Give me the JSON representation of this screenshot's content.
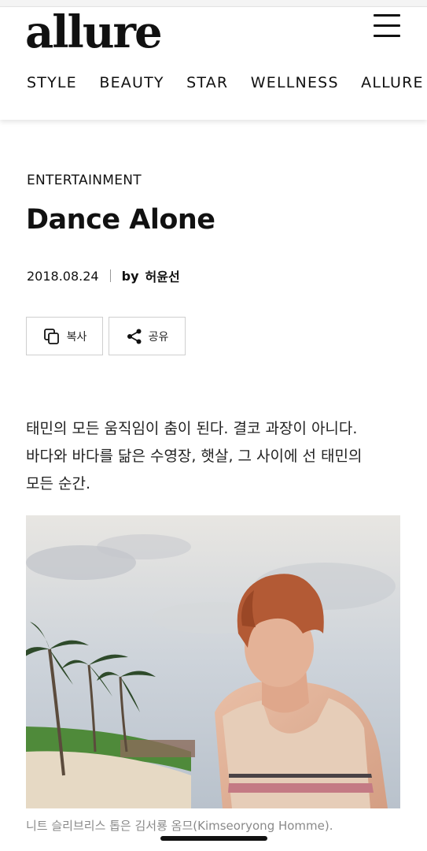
{
  "header": {
    "logo": "allure",
    "menu_icon": "hamburger-menu-icon",
    "nav": [
      "STYLE",
      "BEAUTY",
      "STAR",
      "WELLNESS",
      "ALLURE CLUB"
    ]
  },
  "article": {
    "category": "ENTERTAINMENT",
    "title": "Dance Alone",
    "date": "2018.08.24",
    "by": "by",
    "author": "허윤선",
    "lede_lines": [
      "태민의 모든 움직임이 춤이 된다. 결코 과장이 아니다.",
      "바다와 바다를 닮은 수영장, 햇살, 그 사이에 선 태민의",
      "모든 순간."
    ],
    "caption": "니트 슬리브리스 톱은 김서룡 옴므(Kimseoryong Homme)."
  },
  "actions": {
    "copy_label": "복사",
    "copy_icon": "copy-icon",
    "share_label": "공유",
    "share_icon": "share-icon"
  },
  "colors": {
    "text": "#111111",
    "border": "#cfcfcf",
    "caption": "#8a8a8a"
  }
}
